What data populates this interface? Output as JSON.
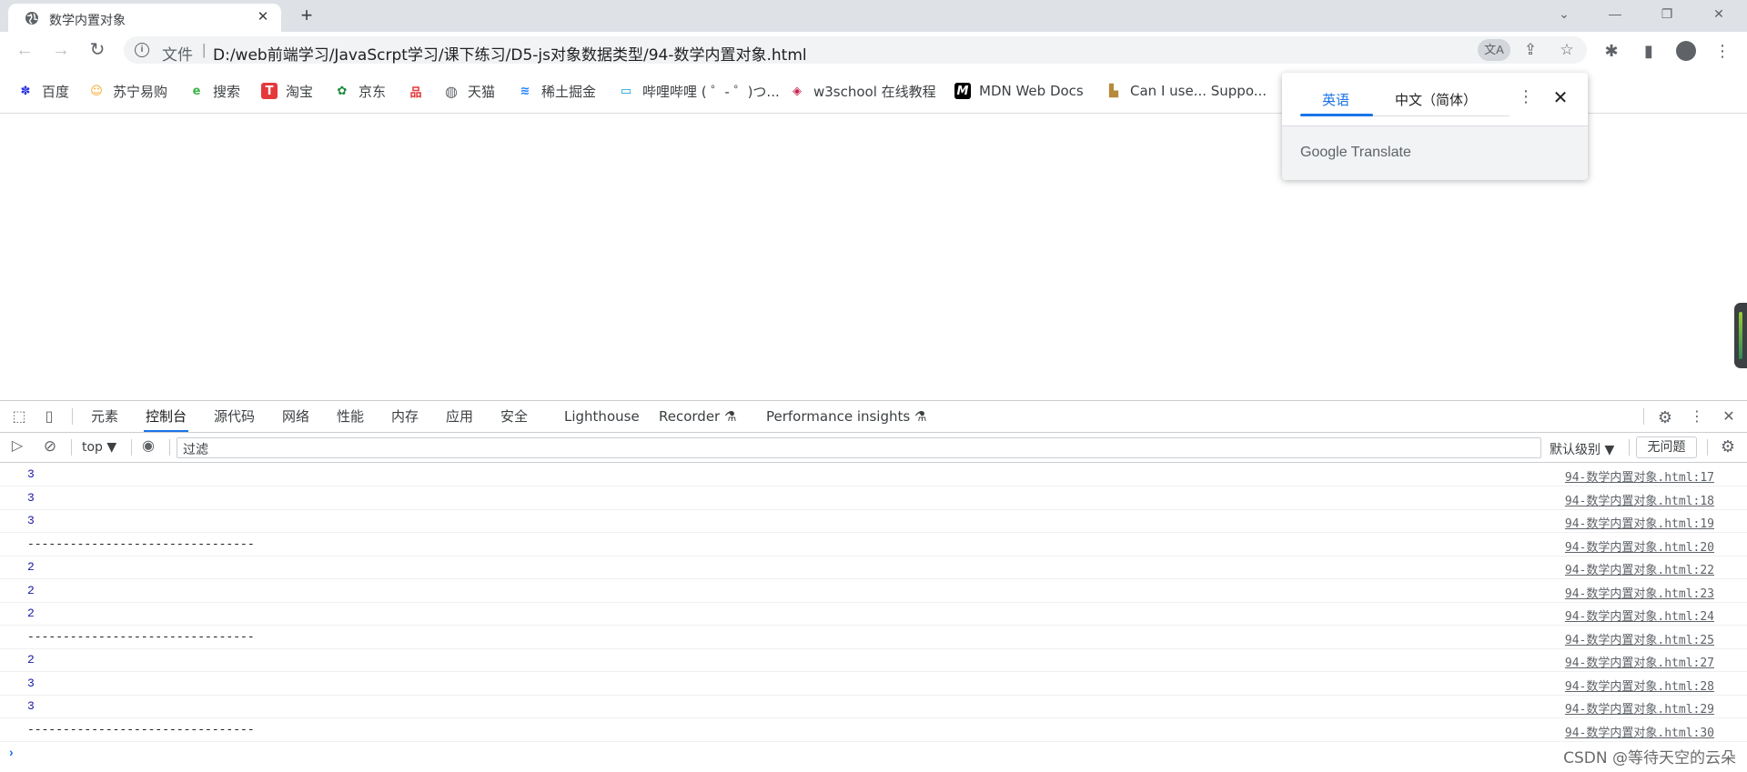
{
  "tab": {
    "title": "数学内置对象",
    "close": "✕",
    "new_tab": "+"
  },
  "window_controls": {
    "collapse": "⌄",
    "minimize": "—",
    "restore": "❐",
    "close": "✕"
  },
  "nav": {
    "back": "←",
    "forward": "→",
    "reload": "↻"
  },
  "omnibox": {
    "info": "i",
    "scheme": "文件",
    "separator": "|",
    "url": "D:/web前端学习/JavaScrpt学习/课下练习/D5-js对象数据类型/94-数学内置对象.html",
    "translate_icon": "文A",
    "share_icon": "⇪",
    "star_icon": "☆"
  },
  "toolbar_icons": {
    "extensions": "✱",
    "sidepanel": "▮",
    "menu": "⋮"
  },
  "bookmarks": [
    {
      "label": "百度",
      "icon": "baidu-icon",
      "glyph": "✽",
      "color": "#2932e1"
    },
    {
      "label": "苏宁易购",
      "icon": "suning-icon",
      "glyph": "☺",
      "color": "#f5a623"
    },
    {
      "label": "搜索",
      "icon": "search-e-icon",
      "glyph": "e",
      "color": "#3db54a"
    },
    {
      "label": "淘宝",
      "icon": "taobao-icon",
      "glyph": "T",
      "color": "#e4393c"
    },
    {
      "label": "京东",
      "icon": "jd-icon",
      "glyph": "✿",
      "color": "#1a8a3a"
    },
    {
      "label": "",
      "icon": "grid-icon",
      "glyph": "品",
      "color": "#e4393c"
    },
    {
      "label": "天猫",
      "icon": "globe-icon",
      "glyph": "◍",
      "color": "#5f6368"
    },
    {
      "label": "稀土掘金",
      "icon": "juejin-icon",
      "glyph": "≋",
      "color": "#1e80ff"
    },
    {
      "label": "哔哩哔哩 ( ゜- ゜)つ...",
      "icon": "bilibili-icon",
      "glyph": "▭",
      "color": "#00a1d6"
    },
    {
      "label": "w3school 在线教程",
      "icon": "w3school-icon",
      "glyph": "◈",
      "color": "#c7254e"
    },
    {
      "label": "MDN Web Docs",
      "icon": "mdn-icon",
      "glyph": "M",
      "color": "#000000"
    },
    {
      "label": "Can I use... Suppo...",
      "icon": "caniuse-icon",
      "glyph": "▙",
      "color": "#b58a3a"
    }
  ],
  "translate_popup": {
    "source_lang": "英语",
    "target_lang": "中文（简体）",
    "more": "⋮",
    "close": "✕",
    "brand": "Google Translate"
  },
  "devtools": {
    "tabs": [
      "元素",
      "控制台",
      "源代码",
      "网络",
      "性能",
      "内存",
      "应用",
      "安全",
      "Lighthouse",
      "Recorder ⚗",
      "Performance insights ⚗"
    ],
    "active_tab": "控制台",
    "console_toolbar": {
      "context": "top ▼",
      "filter_placeholder": "过滤",
      "level": "默认级别 ▼",
      "issues": "无问题"
    },
    "icons": {
      "inspect": "⬚",
      "device": "▯",
      "settings": "⚙",
      "menu": "⋮",
      "close": "✕",
      "sidebar": "▷",
      "clear": "⊘",
      "eye": "◉"
    },
    "logs": [
      {
        "message": "3",
        "kind": "num",
        "source": "94-数学内置对象.html:17"
      },
      {
        "message": "3",
        "kind": "num",
        "source": "94-数学内置对象.html:18"
      },
      {
        "message": "3",
        "kind": "num",
        "source": "94-数学内置对象.html:19"
      },
      {
        "message": "--------------------------------",
        "kind": "text",
        "source": "94-数学内置对象.html:20"
      },
      {
        "message": "2",
        "kind": "num",
        "source": "94-数学内置对象.html:22"
      },
      {
        "message": "2",
        "kind": "num",
        "source": "94-数学内置对象.html:23"
      },
      {
        "message": "2",
        "kind": "num",
        "source": "94-数学内置对象.html:24"
      },
      {
        "message": "--------------------------------",
        "kind": "text",
        "source": "94-数学内置对象.html:25"
      },
      {
        "message": "2",
        "kind": "num",
        "source": "94-数学内置对象.html:27"
      },
      {
        "message": "3",
        "kind": "num",
        "source": "94-数学内置对象.html:28"
      },
      {
        "message": "3",
        "kind": "num",
        "source": "94-数学内置对象.html:29"
      },
      {
        "message": "--------------------------------",
        "kind": "text",
        "source": "94-数学内置对象.html:30"
      }
    ],
    "prompt": "›"
  },
  "watermark": "CSDN @等待天空的云朵"
}
